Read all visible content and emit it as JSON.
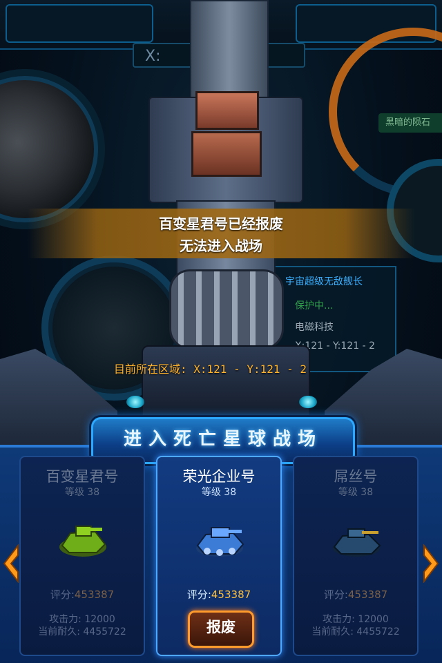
{
  "background": {
    "coordinate_label": "X:",
    "right_tag": "黑暗的陨石",
    "info_panel": {
      "title": "宇宙超级无敌舰长",
      "status": "保护中...",
      "tech": "电磁科技",
      "coords": "X:121 - Y:121 - 2"
    }
  },
  "message": {
    "line1": "百变星君号已经报废",
    "line2": "无法进入战场"
  },
  "zone_text": "目前所在区域: X:121 - Y:121 - 2",
  "enter_button": "进入死亡星球战场",
  "ships": [
    {
      "name": "百变星君号",
      "level": "等级 38",
      "score_label": "评分:",
      "score": "453387",
      "attack": "攻击力: 12000",
      "durability": "当前耐久: 4455722",
      "state": "dim",
      "color": "#7cc51c"
    },
    {
      "name": "荣光企业号",
      "level": "等级 38",
      "score_label": "评分:",
      "score": "453387",
      "action": "报废",
      "state": "selected",
      "color": "#3a7bd5"
    },
    {
      "name": "屌丝号",
      "level": "等级 38",
      "score_label": "评分:",
      "score": "453387",
      "attack": "攻击力: 12000",
      "durability": "当前耐久: 4455722",
      "state": "dim",
      "color": "#2c6aa0"
    }
  ],
  "nav": {
    "left_icon": "arrow-left-icon",
    "right_icon": "arrow-right-icon",
    "accent": "#ff9a1a"
  }
}
